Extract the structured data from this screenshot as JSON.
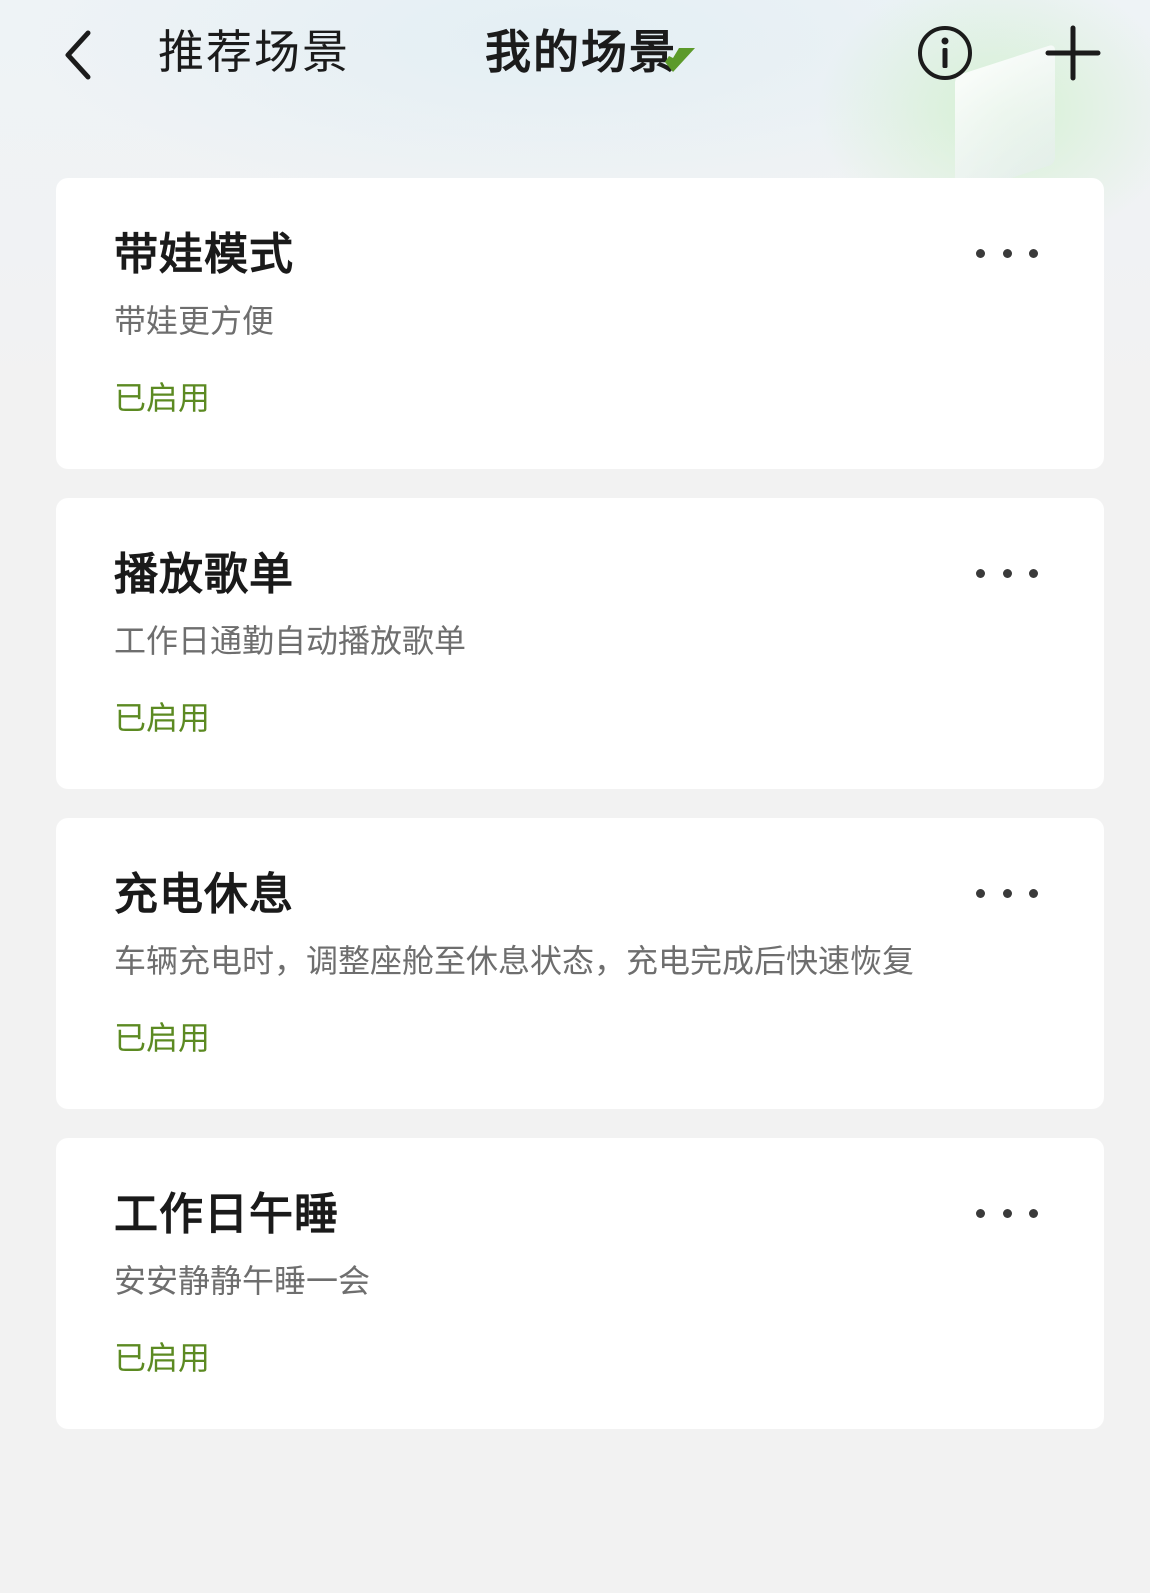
{
  "header": {
    "tabs": [
      {
        "label": "推荐场景",
        "active": false
      },
      {
        "label": "我的场景",
        "active": true
      }
    ],
    "back_icon": "chevron-left-icon",
    "info_icon": "info-circle-icon",
    "add_icon": "plus-icon",
    "accent_color": "#5c8a22"
  },
  "scenes": [
    {
      "title": "带娃模式",
      "description": "带娃更方便",
      "status": "已启用"
    },
    {
      "title": "播放歌单",
      "description": "工作日通勤自动播放歌单",
      "status": "已启用"
    },
    {
      "title": "充电休息",
      "description": "车辆充电时，调整座舱至休息状态，充电完成后快速恢复",
      "status": "已启用"
    },
    {
      "title": "工作日午睡",
      "description": "安安静静午睡一会",
      "status": "已启用"
    }
  ]
}
